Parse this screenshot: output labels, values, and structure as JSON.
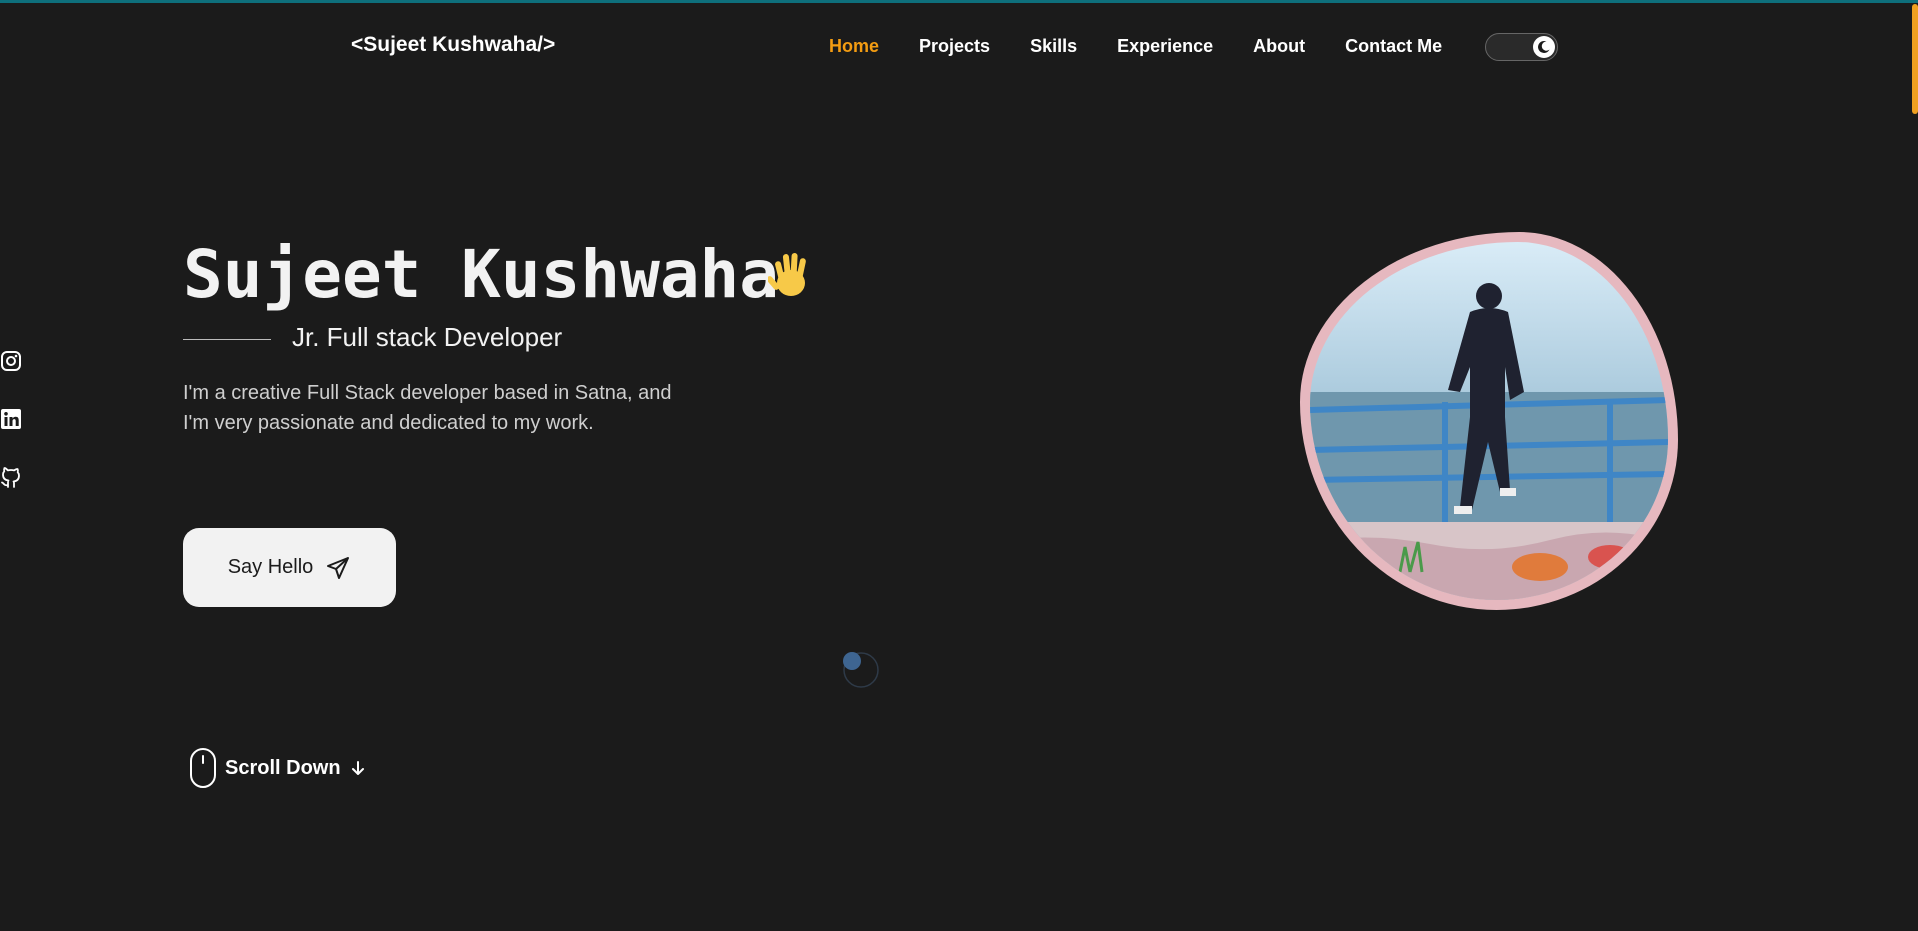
{
  "header": {
    "logo": "<Sujeet Kushwaha/>",
    "nav": [
      {
        "label": "Home",
        "active": true
      },
      {
        "label": "Projects",
        "active": false
      },
      {
        "label": "Skills",
        "active": false
      },
      {
        "label": "Experience",
        "active": false
      },
      {
        "label": "About",
        "active": false
      },
      {
        "label": "Contact Me",
        "active": false
      }
    ],
    "theme_toggle_icon": "moon-icon"
  },
  "hero": {
    "name": "Sujeet Kushwaha",
    "wave_icon": "waving-hand-icon",
    "subtitle": "Jr. Full stack Developer",
    "description": "I'm a creative Full Stack developer based in Satna, and I'm very passionate and dedicated to my work.",
    "cta_label": "Say Hello",
    "cta_icon": "paper-plane-icon",
    "scroll_label": "Scroll Down",
    "scroll_icons": [
      "mouse-icon",
      "arrow-down-icon"
    ]
  },
  "socials": [
    "instagram-icon",
    "linkedin-icon",
    "github-icon"
  ],
  "colors": {
    "background": "#1b1b1b",
    "accent": "#f39c12",
    "text": "#f2f2f2",
    "blob_border": "#e6b8bf"
  }
}
